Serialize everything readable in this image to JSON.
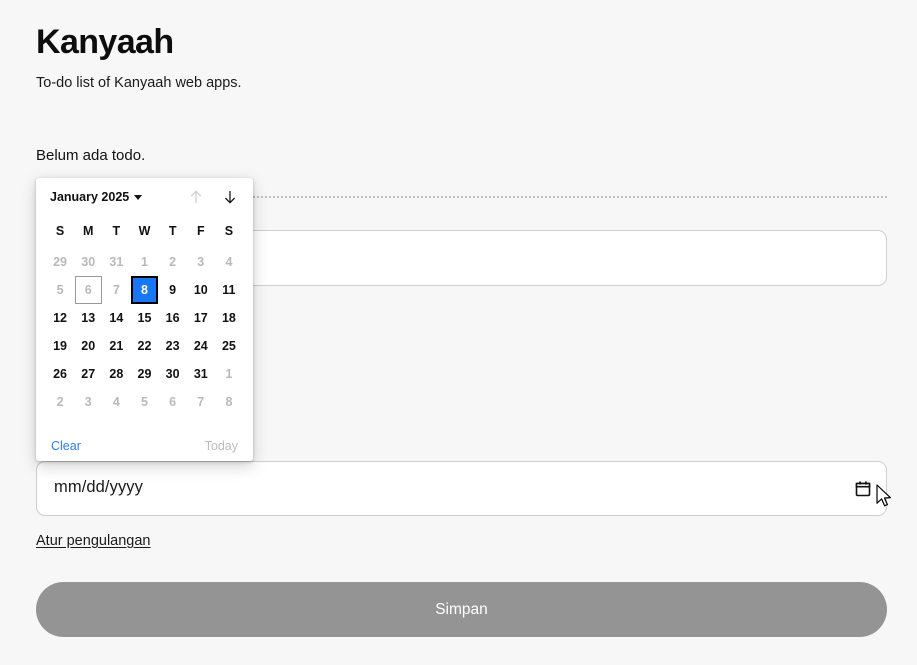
{
  "app": {
    "title": "Kanyaah",
    "subtitle": "To-do list of Kanyaah web apps.",
    "empty_state": "Belum ada todo."
  },
  "form": {
    "note_value": "",
    "date_placeholder": "mm/dd/yyyy",
    "date_value": "mm/dd/yyyy",
    "calendar_icon": "calendar-icon",
    "repeat_link": "Atur pengulangan",
    "save_label": "Simpan",
    "save_disabled": true,
    "save_color": "#949494"
  },
  "datepicker": {
    "month_label": "January 2025",
    "caret_icon": "chevron-down-icon",
    "prev_icon": "arrow-up-icon",
    "next_icon": "arrow-down-icon",
    "prev_disabled": true,
    "next_disabled": false,
    "accent_color": "#1878f3",
    "link_color": "#2b7de9",
    "weekdays": [
      "S",
      "M",
      "T",
      "W",
      "T",
      "F",
      "S"
    ],
    "weeks": [
      [
        {
          "d": "29",
          "state": "muted"
        },
        {
          "d": "30",
          "state": "muted"
        },
        {
          "d": "31",
          "state": "muted"
        },
        {
          "d": "1",
          "state": "muted"
        },
        {
          "d": "2",
          "state": "muted"
        },
        {
          "d": "3",
          "state": "muted"
        },
        {
          "d": "4",
          "state": "muted"
        }
      ],
      [
        {
          "d": "5",
          "state": "muted"
        },
        {
          "d": "6",
          "state": "muted-focus"
        },
        {
          "d": "7",
          "state": "muted"
        },
        {
          "d": "8",
          "state": "selected"
        },
        {
          "d": "9",
          "state": "normal"
        },
        {
          "d": "10",
          "state": "normal"
        },
        {
          "d": "11",
          "state": "normal"
        }
      ],
      [
        {
          "d": "12",
          "state": "normal"
        },
        {
          "d": "13",
          "state": "normal"
        },
        {
          "d": "14",
          "state": "normal"
        },
        {
          "d": "15",
          "state": "normal"
        },
        {
          "d": "16",
          "state": "normal"
        },
        {
          "d": "17",
          "state": "normal"
        },
        {
          "d": "18",
          "state": "normal"
        }
      ],
      [
        {
          "d": "19",
          "state": "normal"
        },
        {
          "d": "20",
          "state": "normal"
        },
        {
          "d": "21",
          "state": "normal"
        },
        {
          "d": "22",
          "state": "normal"
        },
        {
          "d": "23",
          "state": "normal"
        },
        {
          "d": "24",
          "state": "normal"
        },
        {
          "d": "25",
          "state": "normal"
        }
      ],
      [
        {
          "d": "26",
          "state": "normal"
        },
        {
          "d": "27",
          "state": "normal"
        },
        {
          "d": "28",
          "state": "normal"
        },
        {
          "d": "29",
          "state": "normal"
        },
        {
          "d": "30",
          "state": "normal"
        },
        {
          "d": "31",
          "state": "normal"
        },
        {
          "d": "1",
          "state": "muted"
        }
      ],
      [
        {
          "d": "2",
          "state": "muted"
        },
        {
          "d": "3",
          "state": "muted"
        },
        {
          "d": "4",
          "state": "muted"
        },
        {
          "d": "5",
          "state": "muted"
        },
        {
          "d": "6",
          "state": "muted"
        },
        {
          "d": "7",
          "state": "muted"
        },
        {
          "d": "8",
          "state": "muted"
        }
      ]
    ],
    "clear_label": "Clear",
    "today_label": "Today",
    "today_disabled": true
  }
}
